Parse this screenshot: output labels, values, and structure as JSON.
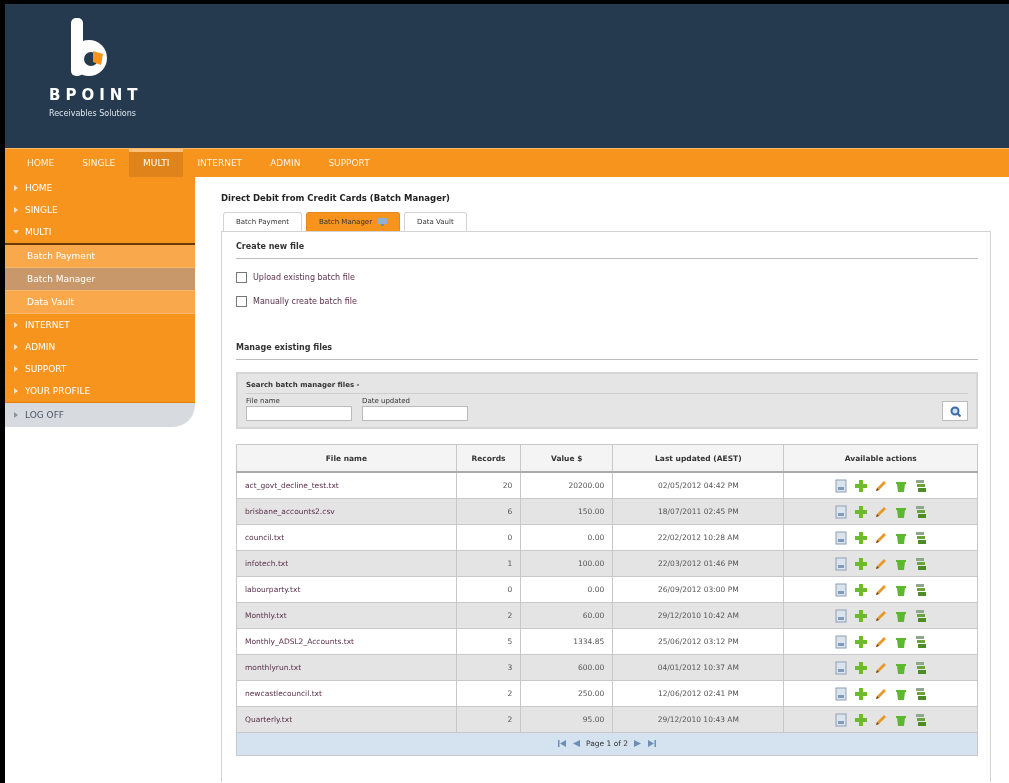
{
  "header": {
    "logo_name": "BPOINT",
    "logo_tagline": "Receivables Solutions"
  },
  "top_nav": [
    {
      "label": "HOME",
      "selected": false
    },
    {
      "label": "SINGLE",
      "selected": false
    },
    {
      "label": "MULTI",
      "selected": true
    },
    {
      "label": "INTERNET",
      "selected": false
    },
    {
      "label": "ADMIN",
      "selected": false
    },
    {
      "label": "SUPPORT",
      "selected": false
    }
  ],
  "sidebar": {
    "items": [
      {
        "label": "HOME",
        "expanded": false
      },
      {
        "label": "SINGLE",
        "expanded": false
      },
      {
        "label": "MULTI",
        "expanded": true,
        "children": [
          {
            "label": "Batch Payment",
            "selected": false
          },
          {
            "label": "Batch Manager",
            "selected": true
          },
          {
            "label": "Data Vault",
            "selected": false
          }
        ]
      },
      {
        "label": "INTERNET",
        "expanded": false
      },
      {
        "label": "ADMIN",
        "expanded": false
      },
      {
        "label": "SUPPORT",
        "expanded": false
      },
      {
        "label": "YOUR PROFILE",
        "expanded": false
      }
    ],
    "log_off": "LOG OFF"
  },
  "page_title": "Direct Debit from Credit Cards (Batch Manager)",
  "tabs": [
    {
      "label": "Batch Payment",
      "selected": false
    },
    {
      "label": "Batch Manager",
      "selected": true
    },
    {
      "label": "Data Vault",
      "selected": false
    }
  ],
  "create_section": {
    "heading": "Create new file",
    "options": [
      {
        "label": "Upload existing batch file",
        "checked": false
      },
      {
        "label": "Manually create batch file",
        "checked": false
      }
    ]
  },
  "manage_section": {
    "heading": "Manage existing files"
  },
  "search": {
    "heading": "Search batch manager files -",
    "fields": [
      {
        "label": "File name"
      },
      {
        "label": "Date updated"
      }
    ]
  },
  "table": {
    "columns": [
      "File name",
      "Records",
      "Value $",
      "Last updated (AEST)",
      "Available actions"
    ],
    "rows": [
      [
        "act_govt_decline_test.txt",
        "20",
        "20200.00",
        "02/05/2012 04:42 PM"
      ],
      [
        "brisbane_accounts2.csv",
        "6",
        "150.00",
        "18/07/2011 02:45 PM"
      ],
      [
        "council.txt",
        "0",
        "0.00",
        "22/02/2012 10:28 AM"
      ],
      [
        "infotech.txt",
        "1",
        "100.00",
        "22/03/2012 01:46 PM"
      ],
      [
        "labourparty.txt",
        "0",
        "0.00",
        "26/09/2012 03:00 PM"
      ],
      [
        "Monthly.txt",
        "2",
        "60.00",
        "29/12/2010 10:42 AM"
      ],
      [
        "Monthly_ADSL2_Accounts.txt",
        "5",
        "1334.85",
        "25/06/2012 03:12 PM"
      ],
      [
        "monthlyrun.txt",
        "3",
        "600.00",
        "04/01/2012 10:37 AM"
      ],
      [
        "newcastlecouncil.txt",
        "2",
        "250.00",
        "12/06/2012 02:41 PM"
      ],
      [
        "Quarterly.txt",
        "2",
        "95.00",
        "29/12/2010 10:43 AM"
      ]
    ]
  },
  "pagination": {
    "label": "Page 1 of 2"
  }
}
